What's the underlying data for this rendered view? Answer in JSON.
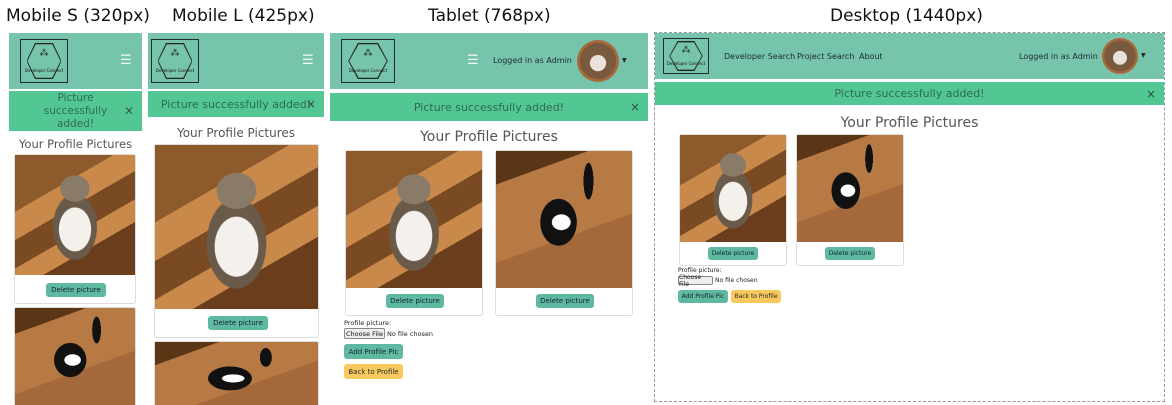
{
  "labels": [
    "Mobile S (320px)",
    "Mobile L (425px)",
    "Tablet (768px)",
    "Desktop (1440px)"
  ],
  "brand": {
    "logo_text": "Developer Connect"
  },
  "nav": {
    "links": [
      "Developer Search",
      "Project Search",
      "About"
    ],
    "logged_in": "Logged in as Admin"
  },
  "alert": {
    "message": "Picture successfully added!",
    "close": "×"
  },
  "page_title": "Your Profile Pictures",
  "buttons": {
    "delete": "Delete picture",
    "add": "Add Profile Pic",
    "back": "Back to Profile",
    "choose_file": "Choose File"
  },
  "form": {
    "label": "Profile picture:",
    "file_status": "No file chosen"
  },
  "icons": {
    "menu": "hamburger-menu-icon",
    "close": "close-icon",
    "dropdown": "caret-down-icon"
  },
  "colors": {
    "navbar": "#77c4ad",
    "alert": "#53c793",
    "green_button": "#5fb9a0",
    "yellow_button": "#f8c95d"
  }
}
